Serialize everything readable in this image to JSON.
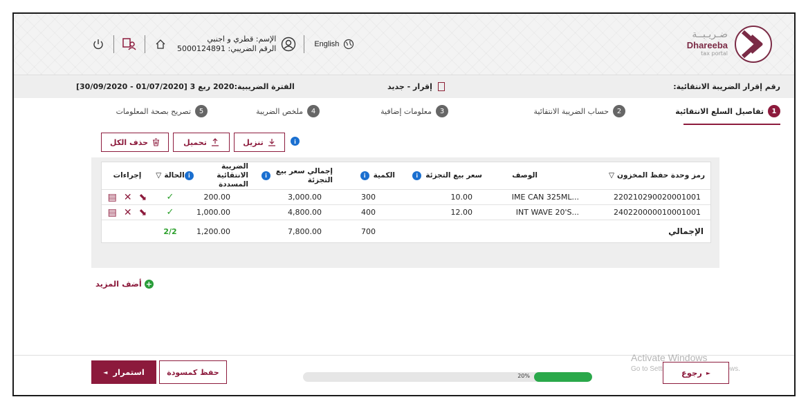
{
  "header": {
    "logo_ar": "ضـريـبــة",
    "logo_en": "Dhareeba",
    "logo_sub": "tax portal",
    "language": "English",
    "user_name": "الإسم: قطري و اجنبي",
    "tax_id": "الرقم الضريبي: 5000124891",
    "icons": [
      "globe-icon",
      "user-icon",
      "home-icon",
      "switch-account-icon",
      "power-icon"
    ]
  },
  "info_bar": {
    "declaration_number": "رقم إقرار الضريبة الانتقائية:",
    "status": "إقرار - جديد",
    "tax_period": "الفترة الضريبية:2020 ربع 3 [01/07/2020 - 30/09/2020]"
  },
  "steps": [
    {
      "num": "1",
      "label": "تفاصيل السلع الانتقائية",
      "active": true
    },
    {
      "num": "2",
      "label": "حساب الضريبة الانتقائية",
      "active": false
    },
    {
      "num": "3",
      "label": "معلومات إضافية",
      "active": false
    },
    {
      "num": "4",
      "label": "ملخص الضريبة",
      "active": false
    },
    {
      "num": "5",
      "label": "تصريح بصحة المعلومات",
      "active": false
    }
  ],
  "toolbar": {
    "download": "تنزيل",
    "upload": "تحميل",
    "delete_all": "حذف الكل"
  },
  "table": {
    "headers": {
      "sku": "رمز وحدة حفظ المخزون",
      "description": "الوصف",
      "retail_price": "سعر بيع التجزئة",
      "quantity": "الكمية",
      "total_retail": "إجمالي سعر بيع التجزئة",
      "excise_paid": "الضريبة الانتقائية المسددة",
      "status": "الحالة",
      "actions": "إجراءات"
    },
    "rows": [
      {
        "sku": "220210290020001001",
        "description": "IME CAN 325ML...",
        "retail_price": "10.00",
        "quantity": "300",
        "total_retail": "3,000.00",
        "excise_paid": "200.00",
        "status": "✓"
      },
      {
        "sku": "240220000010001001",
        "description": "INT WAVE 20'S...",
        "retail_price": "12.00",
        "quantity": "400",
        "total_retail": "4,800.00",
        "excise_paid": "1,000.00",
        "status": "✓"
      }
    ],
    "total": {
      "label": "الإجمالي",
      "quantity": "700",
      "total_retail": "7,800.00",
      "excise_paid": "1,200.00",
      "count": "2/2"
    }
  },
  "add_more": "أضف المزيد",
  "footer": {
    "continue": "استمرار",
    "save_draft": "حفظ كمسودة",
    "progress": 20,
    "progress_label": "20%",
    "back": "رجوع"
  },
  "watermark": {
    "line1": "Activate Windows",
    "line2": "Go to Settings to activate Windows."
  },
  "colors": {
    "brand": "#8c1a3c",
    "progress": "#2aa84a",
    "ok": "#2ca02c",
    "info": "#1a6fd0"
  }
}
